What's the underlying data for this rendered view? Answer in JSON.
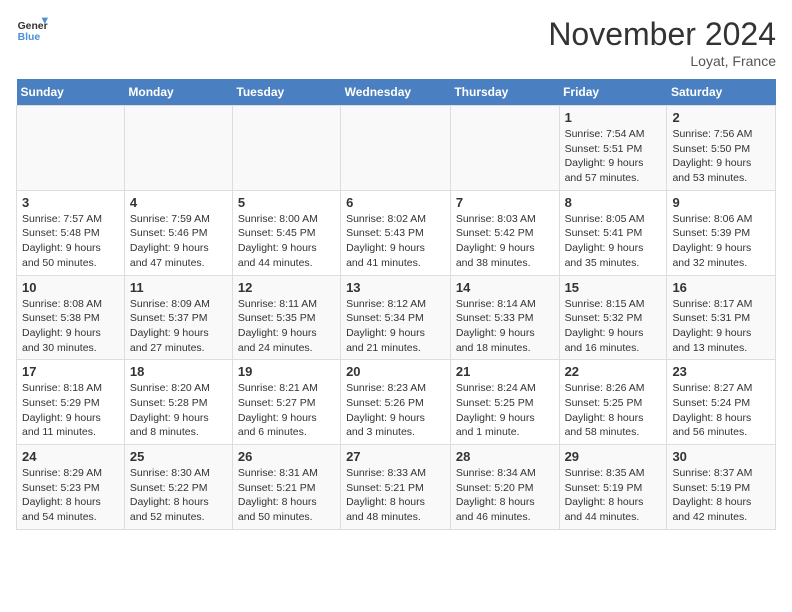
{
  "header": {
    "logo_line1": "General",
    "logo_line2": "Blue",
    "month_title": "November 2024",
    "location": "Loyat, France"
  },
  "days_of_week": [
    "Sunday",
    "Monday",
    "Tuesday",
    "Wednesday",
    "Thursday",
    "Friday",
    "Saturday"
  ],
  "weeks": [
    [
      {
        "day": "",
        "info": ""
      },
      {
        "day": "",
        "info": ""
      },
      {
        "day": "",
        "info": ""
      },
      {
        "day": "",
        "info": ""
      },
      {
        "day": "",
        "info": ""
      },
      {
        "day": "1",
        "info": "Sunrise: 7:54 AM\nSunset: 5:51 PM\nDaylight: 9 hours and 57 minutes."
      },
      {
        "day": "2",
        "info": "Sunrise: 7:56 AM\nSunset: 5:50 PM\nDaylight: 9 hours and 53 minutes."
      }
    ],
    [
      {
        "day": "3",
        "info": "Sunrise: 7:57 AM\nSunset: 5:48 PM\nDaylight: 9 hours and 50 minutes."
      },
      {
        "day": "4",
        "info": "Sunrise: 7:59 AM\nSunset: 5:46 PM\nDaylight: 9 hours and 47 minutes."
      },
      {
        "day": "5",
        "info": "Sunrise: 8:00 AM\nSunset: 5:45 PM\nDaylight: 9 hours and 44 minutes."
      },
      {
        "day": "6",
        "info": "Sunrise: 8:02 AM\nSunset: 5:43 PM\nDaylight: 9 hours and 41 minutes."
      },
      {
        "day": "7",
        "info": "Sunrise: 8:03 AM\nSunset: 5:42 PM\nDaylight: 9 hours and 38 minutes."
      },
      {
        "day": "8",
        "info": "Sunrise: 8:05 AM\nSunset: 5:41 PM\nDaylight: 9 hours and 35 minutes."
      },
      {
        "day": "9",
        "info": "Sunrise: 8:06 AM\nSunset: 5:39 PM\nDaylight: 9 hours and 32 minutes."
      }
    ],
    [
      {
        "day": "10",
        "info": "Sunrise: 8:08 AM\nSunset: 5:38 PM\nDaylight: 9 hours and 30 minutes."
      },
      {
        "day": "11",
        "info": "Sunrise: 8:09 AM\nSunset: 5:37 PM\nDaylight: 9 hours and 27 minutes."
      },
      {
        "day": "12",
        "info": "Sunrise: 8:11 AM\nSunset: 5:35 PM\nDaylight: 9 hours and 24 minutes."
      },
      {
        "day": "13",
        "info": "Sunrise: 8:12 AM\nSunset: 5:34 PM\nDaylight: 9 hours and 21 minutes."
      },
      {
        "day": "14",
        "info": "Sunrise: 8:14 AM\nSunset: 5:33 PM\nDaylight: 9 hours and 18 minutes."
      },
      {
        "day": "15",
        "info": "Sunrise: 8:15 AM\nSunset: 5:32 PM\nDaylight: 9 hours and 16 minutes."
      },
      {
        "day": "16",
        "info": "Sunrise: 8:17 AM\nSunset: 5:31 PM\nDaylight: 9 hours and 13 minutes."
      }
    ],
    [
      {
        "day": "17",
        "info": "Sunrise: 8:18 AM\nSunset: 5:29 PM\nDaylight: 9 hours and 11 minutes."
      },
      {
        "day": "18",
        "info": "Sunrise: 8:20 AM\nSunset: 5:28 PM\nDaylight: 9 hours and 8 minutes."
      },
      {
        "day": "19",
        "info": "Sunrise: 8:21 AM\nSunset: 5:27 PM\nDaylight: 9 hours and 6 minutes."
      },
      {
        "day": "20",
        "info": "Sunrise: 8:23 AM\nSunset: 5:26 PM\nDaylight: 9 hours and 3 minutes."
      },
      {
        "day": "21",
        "info": "Sunrise: 8:24 AM\nSunset: 5:25 PM\nDaylight: 9 hours and 1 minute."
      },
      {
        "day": "22",
        "info": "Sunrise: 8:26 AM\nSunset: 5:25 PM\nDaylight: 8 hours and 58 minutes."
      },
      {
        "day": "23",
        "info": "Sunrise: 8:27 AM\nSunset: 5:24 PM\nDaylight: 8 hours and 56 minutes."
      }
    ],
    [
      {
        "day": "24",
        "info": "Sunrise: 8:29 AM\nSunset: 5:23 PM\nDaylight: 8 hours and 54 minutes."
      },
      {
        "day": "25",
        "info": "Sunrise: 8:30 AM\nSunset: 5:22 PM\nDaylight: 8 hours and 52 minutes."
      },
      {
        "day": "26",
        "info": "Sunrise: 8:31 AM\nSunset: 5:21 PM\nDaylight: 8 hours and 50 minutes."
      },
      {
        "day": "27",
        "info": "Sunrise: 8:33 AM\nSunset: 5:21 PM\nDaylight: 8 hours and 48 minutes."
      },
      {
        "day": "28",
        "info": "Sunrise: 8:34 AM\nSunset: 5:20 PM\nDaylight: 8 hours and 46 minutes."
      },
      {
        "day": "29",
        "info": "Sunrise: 8:35 AM\nSunset: 5:19 PM\nDaylight: 8 hours and 44 minutes."
      },
      {
        "day": "30",
        "info": "Sunrise: 8:37 AM\nSunset: 5:19 PM\nDaylight: 8 hours and 42 minutes."
      }
    ]
  ]
}
